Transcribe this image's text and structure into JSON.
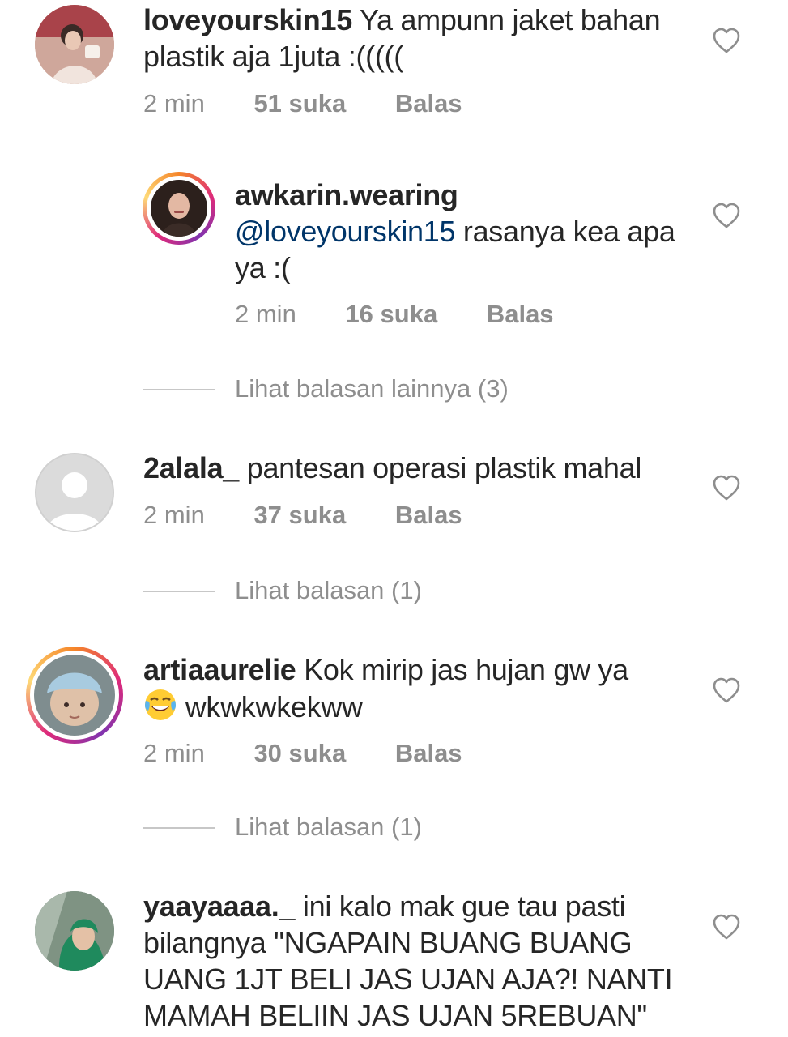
{
  "comments": [
    {
      "username": "loveyourskin15",
      "text": " Ya ampunn jaket bahan plastik aja 1juta :(((((",
      "time": "2 min",
      "likes": "51 suka",
      "reply": "Balas"
    },
    {
      "username": "awkarin.wearing",
      "mention": "@loveyourskin15",
      "text": " rasanya kea apa ya :(",
      "time": "2 min",
      "likes": "16 suka",
      "reply": "Balas"
    },
    {
      "username": "2alala_",
      "text": " pantesan operasi plastik mahal",
      "time": "2 min",
      "likes": "37 suka",
      "reply": "Balas"
    },
    {
      "username": "artiaaurelie",
      "text": " Kok mirip jas hujan gw ya",
      "emoji": "face-with-tears-of-joy",
      "text2": " wkwkwkekww",
      "time": "2 min",
      "likes": "30 suka",
      "reply": "Balas"
    },
    {
      "username": "yaayaaaa._",
      "text": " ini kalo mak gue tau pasti bilangnya \"NGAPAIN BUANG BUANG UANG 1JT BELI JAS UJAN AJA?! NANTI MAMAH BELIIN JAS UJAN 5REBUAN\""
    }
  ],
  "view_replies": [
    {
      "label": "Lihat balasan lainnya (3)"
    },
    {
      "label": "Lihat balasan (1)"
    },
    {
      "label": "Lihat balasan (1)"
    }
  ],
  "icons": {
    "like": "heart-outline-icon"
  },
  "colors": {
    "text": "#262626",
    "meta": "#8e8e8e",
    "mention": "#003569",
    "divider": "#c7c7c7"
  }
}
